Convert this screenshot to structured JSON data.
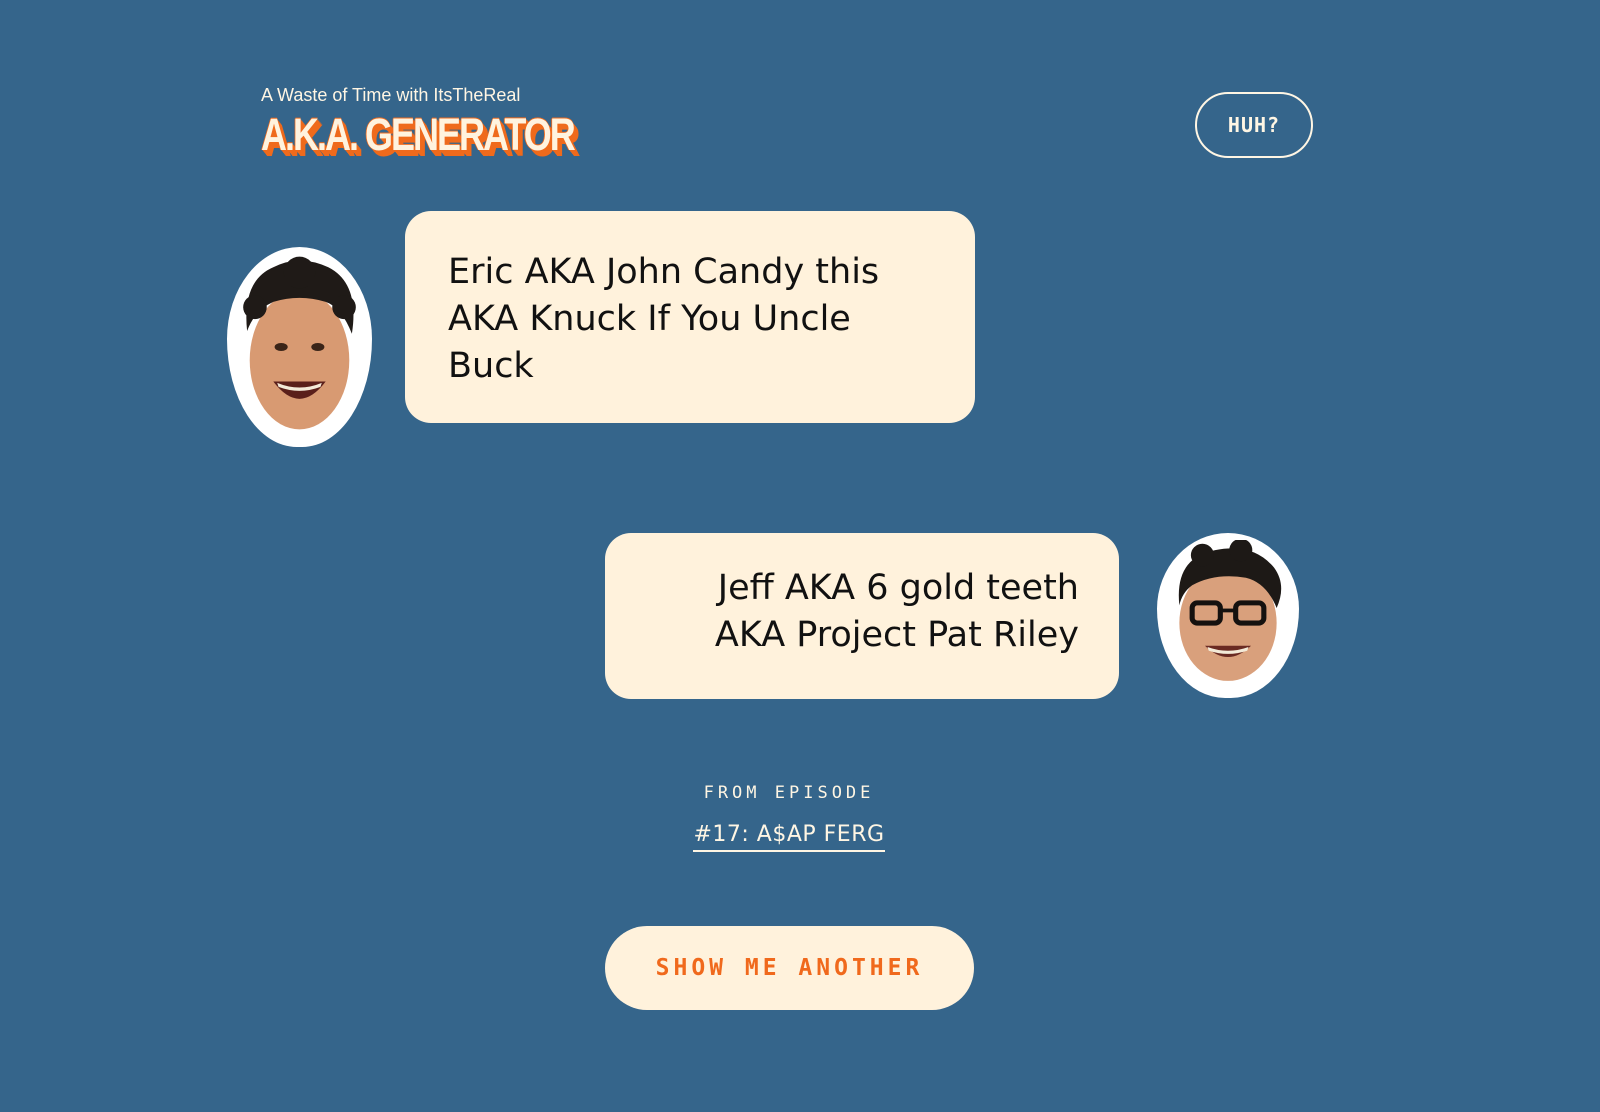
{
  "header": {
    "subtitle": "A Waste of Time with ItsTheReal",
    "title": "A.K.A. GENERATOR",
    "help_button": "HUH?"
  },
  "messages": [
    {
      "speaker": "Eric",
      "side": "left",
      "text": "Eric AKA John Candy this AKA Knuck If You Uncle Buck"
    },
    {
      "speaker": "Jeff",
      "side": "right",
      "text": "Jeff AKA 6 gold teeth AKA Project Pat Riley"
    }
  ],
  "episode": {
    "label": "FROM EPISODE",
    "title": "#17: A$AP FERG"
  },
  "action": {
    "show_another_label": "SHOW ME ANOTHER"
  },
  "colors": {
    "background": "#35658b",
    "bubble": "#fff2dc",
    "accent": "#f0691c",
    "text_light": "#fff6e4"
  },
  "icons": {
    "eric_avatar": "eric-face-sticker",
    "jeff_avatar": "jeff-face-sticker"
  }
}
